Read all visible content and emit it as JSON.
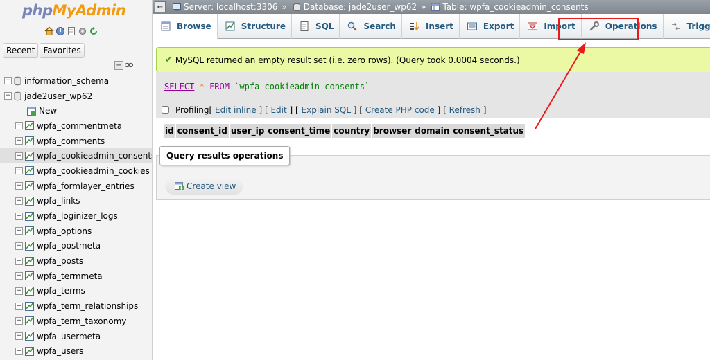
{
  "logo": {
    "part1": "php",
    "part2": "MyAdmin"
  },
  "quick_icons": [
    "home-icon",
    "logout-icon",
    "docs-icon",
    "settings-icon",
    "reload-icon"
  ],
  "nav_buttons": {
    "recent": "Recent",
    "favorites": "Favorites"
  },
  "tree": {
    "databases": [
      {
        "name": "information_schema",
        "expanded": false
      },
      {
        "name": "jade2user_wp62",
        "expanded": true
      }
    ],
    "new_label": "New",
    "tables": [
      "wpfa_commentmeta",
      "wpfa_comments",
      "wpfa_cookieadmin_consents",
      "wpfa_cookieadmin_cookies",
      "wpfa_formlayer_entries",
      "wpfa_links",
      "wpfa_loginizer_logs",
      "wpfa_options",
      "wpfa_postmeta",
      "wpfa_posts",
      "wpfa_termmeta",
      "wpfa_terms",
      "wpfa_term_relationships",
      "wpfa_term_taxonomy",
      "wpfa_usermeta",
      "wpfa_users"
    ],
    "selected_table": "wpfa_cookieadmin_consents"
  },
  "breadcrumb": {
    "server": "Server: localhost:3306",
    "database": "Database: jade2user_wp62",
    "table": "Table: wpfa_cookieadmin_consents",
    "separator": "»"
  },
  "tabs": [
    {
      "label": "Browse",
      "icon": "browse-icon",
      "active": true
    },
    {
      "label": "Structure",
      "icon": "structure-icon",
      "active": false
    },
    {
      "label": "SQL",
      "icon": "sql-icon",
      "active": false
    },
    {
      "label": "Search",
      "icon": "search-icon",
      "active": false
    },
    {
      "label": "Insert",
      "icon": "insert-icon",
      "active": false
    },
    {
      "label": "Export",
      "icon": "export-icon",
      "active": false
    },
    {
      "label": "Import",
      "icon": "import-icon",
      "active": false
    },
    {
      "label": "Operations",
      "icon": "wrench-icon",
      "active": false
    },
    {
      "label": "Triggers",
      "icon": "triggers-icon",
      "active": false
    }
  ],
  "message": "MySQL returned an empty result set (i.e. zero rows). (Query took 0.0004 seconds.)",
  "sql": {
    "select": "SELECT",
    "star": "*",
    "from": "FROM",
    "table": "`wpfa_cookieadmin_consents`"
  },
  "profiling": {
    "label": "Profiling",
    "links": [
      "Edit inline",
      "Edit",
      "Explain SQL",
      "Create PHP code",
      "Refresh"
    ]
  },
  "result_columns": [
    "id",
    "consent_id",
    "user_ip",
    "consent_time",
    "country",
    "browser",
    "domain",
    "consent_status"
  ],
  "query_results_operations": {
    "legend": "Query results operations",
    "create_view": "Create view"
  },
  "colors": {
    "link": "#235a81",
    "highlight_border": "#e81a1a",
    "success_bg": "#ebf8a4",
    "logo_php": "#7a86b8",
    "logo_myadmin": "#f29b10"
  }
}
